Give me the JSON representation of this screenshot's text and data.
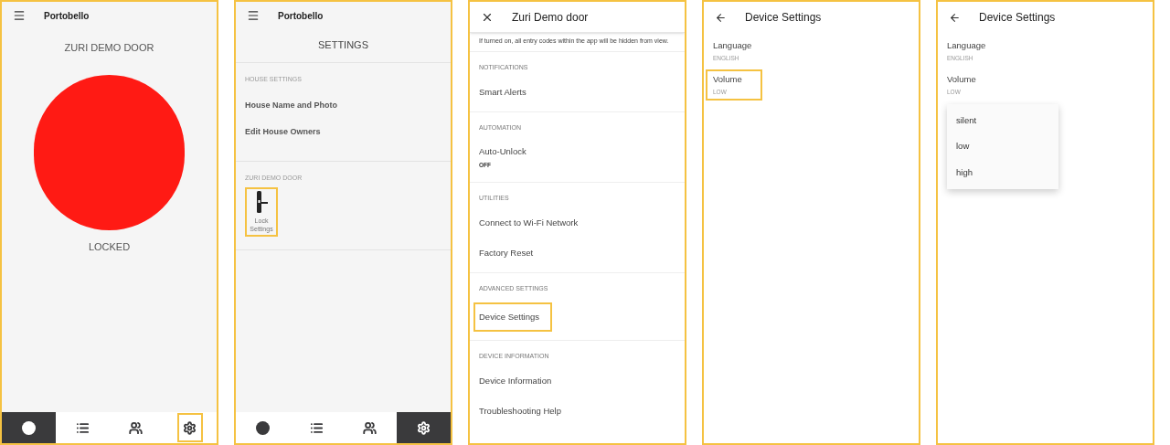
{
  "panels": [
    {
      "kind": "home",
      "header": {
        "kind": "menu",
        "title": "Portobello"
      },
      "heading": "ZURI DEMO DOOR",
      "lock": {
        "color": "#ff1a14",
        "label": "LOCKED"
      },
      "nav": [
        {
          "kind": "circle",
          "selected": true,
          "highlighted": false
        },
        {
          "kind": "list",
          "selected": false,
          "highlighted": false
        },
        {
          "kind": "people",
          "selected": false,
          "highlighted": false
        },
        {
          "kind": "gear",
          "selected": false,
          "highlighted": true
        }
      ]
    },
    {
      "kind": "settings",
      "header": {
        "kind": "menu",
        "title": "Portobello"
      },
      "heading": "SETTINGS",
      "sections": [
        {
          "title": "HOUSE SETTINGS",
          "items": [
            {
              "label": "House Name and Photo"
            },
            {
              "label": "Edit House Owners"
            }
          ]
        },
        {
          "title": "ZURI DEMO DOOR",
          "tiles": [
            {
              "label": "Lock Settings",
              "highlighted": true
            }
          ]
        }
      ],
      "nav": [
        {
          "kind": "circle",
          "selected": false,
          "highlighted": false
        },
        {
          "kind": "list",
          "selected": false,
          "highlighted": false
        },
        {
          "kind": "people",
          "selected": false,
          "highlighted": false
        },
        {
          "kind": "gear",
          "selected": true,
          "highlighted": false
        }
      ]
    },
    {
      "kind": "lock_settings",
      "header": {
        "kind": "close",
        "title": "Zuri Demo door"
      },
      "note": "If turned on, all entry codes within the app will be hidden from view.",
      "sections": [
        {
          "title": "NOTIFICATIONS",
          "items": [
            {
              "label": "Smart Alerts",
              "highlighted": false
            }
          ]
        },
        {
          "title": "AUTOMATION",
          "items": [
            {
              "label": "Auto-Unlock",
              "value": "OFF",
              "highlighted": false
            }
          ]
        },
        {
          "title": "UTILITIES",
          "items": [
            {
              "label": "Connect to Wi-Fi Network",
              "highlighted": false
            },
            {
              "label": "Factory Reset",
              "highlighted": false
            }
          ]
        },
        {
          "title": "ADVANCED SETTINGS",
          "items": [
            {
              "label": "Device Settings",
              "highlighted": true
            }
          ]
        },
        {
          "title": "DEVICE INFORMATION",
          "items": [
            {
              "label": "Device Information",
              "highlighted": false
            },
            {
              "label": "Troubleshooting Help",
              "highlighted": false
            }
          ]
        }
      ]
    },
    {
      "kind": "device_settings",
      "header": {
        "kind": "back",
        "title": "Device Settings"
      },
      "items": [
        {
          "label": "Language",
          "value": "ENGLISH",
          "highlighted": false
        },
        {
          "label": "Volume",
          "value": "LOW",
          "highlighted": true
        }
      ]
    },
    {
      "kind": "device_settings",
      "header": {
        "kind": "back",
        "title": "Device Settings"
      },
      "items": [
        {
          "label": "Language",
          "value": "ENGLISH",
          "highlighted": false
        },
        {
          "label": "Volume",
          "value": "LOW",
          "highlighted": false
        }
      ],
      "menu": [
        "silent",
        "low",
        "high"
      ]
    }
  ]
}
